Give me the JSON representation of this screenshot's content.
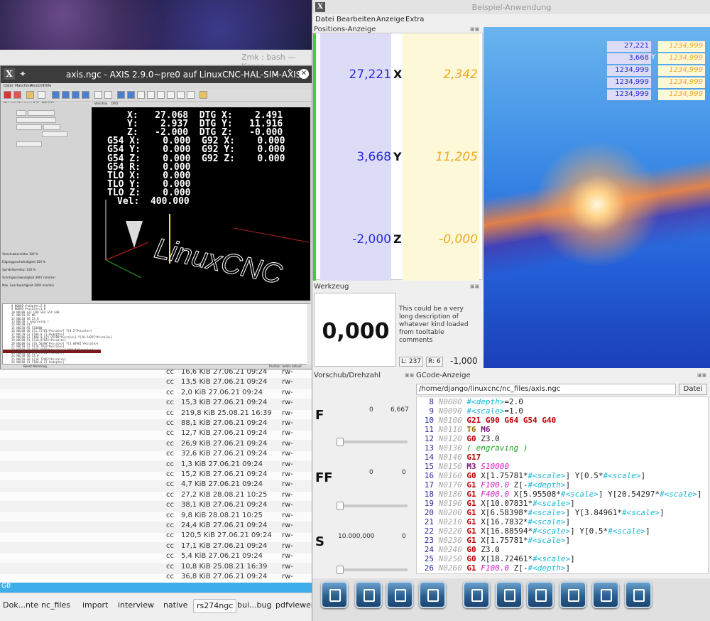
{
  "konsole": {
    "title": "Zmk : bash — Konso",
    "files": [
      {
        "owner": "cc",
        "size": "16,6 KiB",
        "date": "27.06.21 09:24",
        "perm": "rw-"
      },
      {
        "owner": "cc",
        "size": "13,5 KiB",
        "date": "27.06.21 09:24",
        "perm": "rw-"
      },
      {
        "owner": "cc",
        "size": "2,0 KiB",
        "date": "27.06.21 09:24",
        "perm": "rw-"
      },
      {
        "owner": "cc",
        "size": "15,3 KiB",
        "date": "27.06.21 09:24",
        "perm": "rw-"
      },
      {
        "owner": "cc",
        "size": "219,8 KiB",
        "date": "25.08.21 16:39",
        "perm": "rw-"
      },
      {
        "owner": "cc",
        "size": "88,1 KiB",
        "date": "27.06.21 09:24",
        "perm": "rw-"
      },
      {
        "owner": "cc",
        "size": "12,7 KiB",
        "date": "27.06.21 09:24",
        "perm": "rw-"
      },
      {
        "owner": "cc",
        "size": "26,9 KiB",
        "date": "27.06.21 09:24",
        "perm": "rw-"
      },
      {
        "owner": "cc",
        "size": "32,6 KiB",
        "date": "27.06.21 09:24",
        "perm": "rw-"
      },
      {
        "owner": "cc",
        "size": "1,3 KiB",
        "date": "27.06.21 09:24",
        "perm": "rw-"
      },
      {
        "owner": "cc",
        "size": "15,2 KiB",
        "date": "27.06.21 09:24",
        "perm": "rw-"
      },
      {
        "owner": "cc",
        "size": "4,7 KiB",
        "date": "27.06.21 09:24",
        "perm": "rw-"
      },
      {
        "owner": "cc",
        "size": "27,2 KiB",
        "date": "28.08.21 10:25",
        "perm": "rw-"
      },
      {
        "owner": "cc",
        "size": "38,1 KiB",
        "date": "27.06.21 09:24",
        "perm": "rw-"
      },
      {
        "owner": "cc",
        "size": "9,8 KiB",
        "date": "28.08.21 10:25",
        "perm": "rw-"
      },
      {
        "owner": "cc",
        "size": "24,4 KiB",
        "date": "27.06.21 09:24",
        "perm": "rw-"
      },
      {
        "owner": "cc",
        "size": "120,5 KiB",
        "date": "27.06.21 09:24",
        "perm": "rw-"
      },
      {
        "owner": "cc",
        "size": "17,1 KiB",
        "date": "27.06.21 09:24",
        "perm": "rw-"
      },
      {
        "owner": "cc",
        "size": "5,4 KiB",
        "date": "27.06.21 09:24",
        "perm": "rw-"
      },
      {
        "owner": "cc",
        "size": "10,8 KiB",
        "date": "25.08.21 16:39",
        "perm": "rw-"
      },
      {
        "owner": "cc",
        "size": "36,8 KiB",
        "date": "27.06.21 09:24",
        "perm": "rw-"
      }
    ],
    "status": "GB",
    "tabs": [
      "Dok...nte",
      "nc_files",
      "import",
      "interview",
      "native",
      "rs274ngc",
      "bui...bug",
      "pdfviewer"
    ]
  },
  "axis": {
    "title": "axis.ngc - AXIS 2.9.0~pre0 auf LinuxCNC-HAL-SIM-AXIS",
    "menu": [
      "Datei",
      "Maschine",
      "Ansicht",
      "Hilfe"
    ],
    "tabs": [
      "Manuelle Steuerung [F3]",
      "MDI [F5]",
      "Vorschau",
      "DRO"
    ],
    "dro_lines": [
      "X:   27.068  DTG X:    2.491",
      "Y:    2.937  DTG Y:   11.916",
      "Z:   -2.000  DTG Z:   -0.000",
      "G54 X:    0.000  G92 X:    0.000",
      "G54 Y:    0.000  G92 Y:    0.000",
      "G54 Z:    0.000  G92 Z:    0.000",
      "G54 R:    0.000",
      "TLO X:    0.000",
      "TLO Y:    0.000",
      "TLO Z:    0.000",
      "Vel:  400.000"
    ],
    "overrides": [
      {
        "label": "Vorschubkorrektur",
        "value": "100 %"
      },
      {
        "label": "Eilganggeschwindigkeit",
        "value": "100 %"
      },
      {
        "label": "Spindelkorrektur",
        "value": "100 %"
      },
      {
        "label": "Schrittgeschwindigkeit",
        "value": "3907 mm/min"
      },
      {
        "label": "Max. Geschwindigkeit",
        "value": "3000 mm/min"
      }
    ],
    "status_left": "Bereit Werkzeug",
    "status_right": "Position: relativ aktuell"
  },
  "app": {
    "title": "Beispiel-Anwendung",
    "menu": [
      "Datei",
      "Bearbeiten",
      "Anzeige",
      "Extra"
    ],
    "position_title": "Positions-Anzeige",
    "axes": [
      {
        "name": "X",
        "value": "27,221",
        "dtg": "2,342"
      },
      {
        "name": "Y",
        "value": "3,668",
        "dtg": "11,205"
      },
      {
        "name": "Z",
        "value": "-2,000",
        "dtg": "-0,000"
      }
    ],
    "mini_dro": [
      {
        "value": "27,221",
        "axis": "",
        "dtg": "1234,999"
      },
      {
        "value": "3,668",
        "axis": "Y",
        "dtg": "1234,999"
      },
      {
        "value": "1234,999",
        "axis": "",
        "dtg": "1234,999"
      },
      {
        "value": "1234,999",
        "axis": "",
        "dtg": "1234,999"
      },
      {
        "value": "1234,999",
        "axis": "",
        "dtg": "1234,999"
      }
    ],
    "tool_title": "Werkzeug",
    "tool_number": "0,000",
    "tool_desc": "This could be a very long description of whatever kind loaded from tooltable comments",
    "tool_len": "L: 237",
    "tool_rad": "R: 6",
    "tool_val": "-1,000",
    "feed_title": "Vorschub/Drehzahl",
    "feed_rows": [
      {
        "name": "F",
        "min": "0",
        "max": "6,667"
      },
      {
        "name": "FF",
        "min": "0",
        "max": "0"
      },
      {
        "name": "S",
        "min": "10.000,000",
        "max": "0"
      }
    ],
    "gcode_title": "GCode-Anzeige",
    "gcode_path": "/home/django/linuxcnc/nc_files/axis.ngc",
    "gcode_file_btn": "Datei",
    "gcode_lines": [
      {
        "num": "8",
        "n": "N0080",
        "code": " #<depth>=2.0"
      },
      {
        "num": "9",
        "n": "N0090",
        "code": " #<scale>=1.0"
      },
      {
        "num": "10",
        "n": "N0100",
        "code": " G21 G90 G64 G54 G40"
      },
      {
        "num": "11",
        "n": "N0110",
        "code": " T6 M6"
      },
      {
        "num": "12",
        "n": "N0120",
        "code": " G0 Z3.0"
      },
      {
        "num": "13",
        "n": "N0130",
        "code": " ( engraving )"
      },
      {
        "num": "14",
        "n": "N0140",
        "code": " G17"
      },
      {
        "num": "15",
        "n": "N0150",
        "code": " M3 S10000"
      },
      {
        "num": "16",
        "n": "N0160",
        "code": " G0 X[1.75781*#<scale>] Y[0.5*#<scale>]"
      },
      {
        "num": "17",
        "n": "N0170",
        "code": " G1 F100.0 Z[-#<depth>]"
      },
      {
        "num": "18",
        "n": "N0180",
        "code": " G1 F400.0 X[5.95508*#<scale>] Y[20.54297*#<scale>]"
      },
      {
        "num": "19",
        "n": "N0190",
        "code": " G1 X[10.07831*#<scale>]"
      },
      {
        "num": "20",
        "n": "N0200",
        "code": " G1 X[6.58398*#<scale>] Y[3.84961*#<scale>]"
      },
      {
        "num": "21",
        "n": "N0210",
        "code": " G1 X[16.7832*#<scale>]"
      },
      {
        "num": "22",
        "n": "N0220",
        "code": " G1 X[16.88594*#<scale>] Y[0.5*#<scale>]"
      },
      {
        "num": "23",
        "n": "N0230",
        "code": " G1 X[1.75781*#<scale>]"
      },
      {
        "num": "24",
        "n": "N0240",
        "code": " G0 Z3.0"
      },
      {
        "num": "25",
        "n": "N0250",
        "code": " G0 X[18.72461*#<scale>]"
      },
      {
        "num": "26",
        "n": "N0260",
        "code": " G1 F100.0 Z[-#<depth>]"
      }
    ],
    "toolbar_icons": [
      "auto-mode-icon",
      "mdi-mode-icon",
      "manual-mode-icon",
      "edit-mode-icon",
      "run-icon",
      "step-icon",
      "jog-icon",
      "hand-icon",
      "wheel-icon",
      "settings-icon"
    ]
  }
}
